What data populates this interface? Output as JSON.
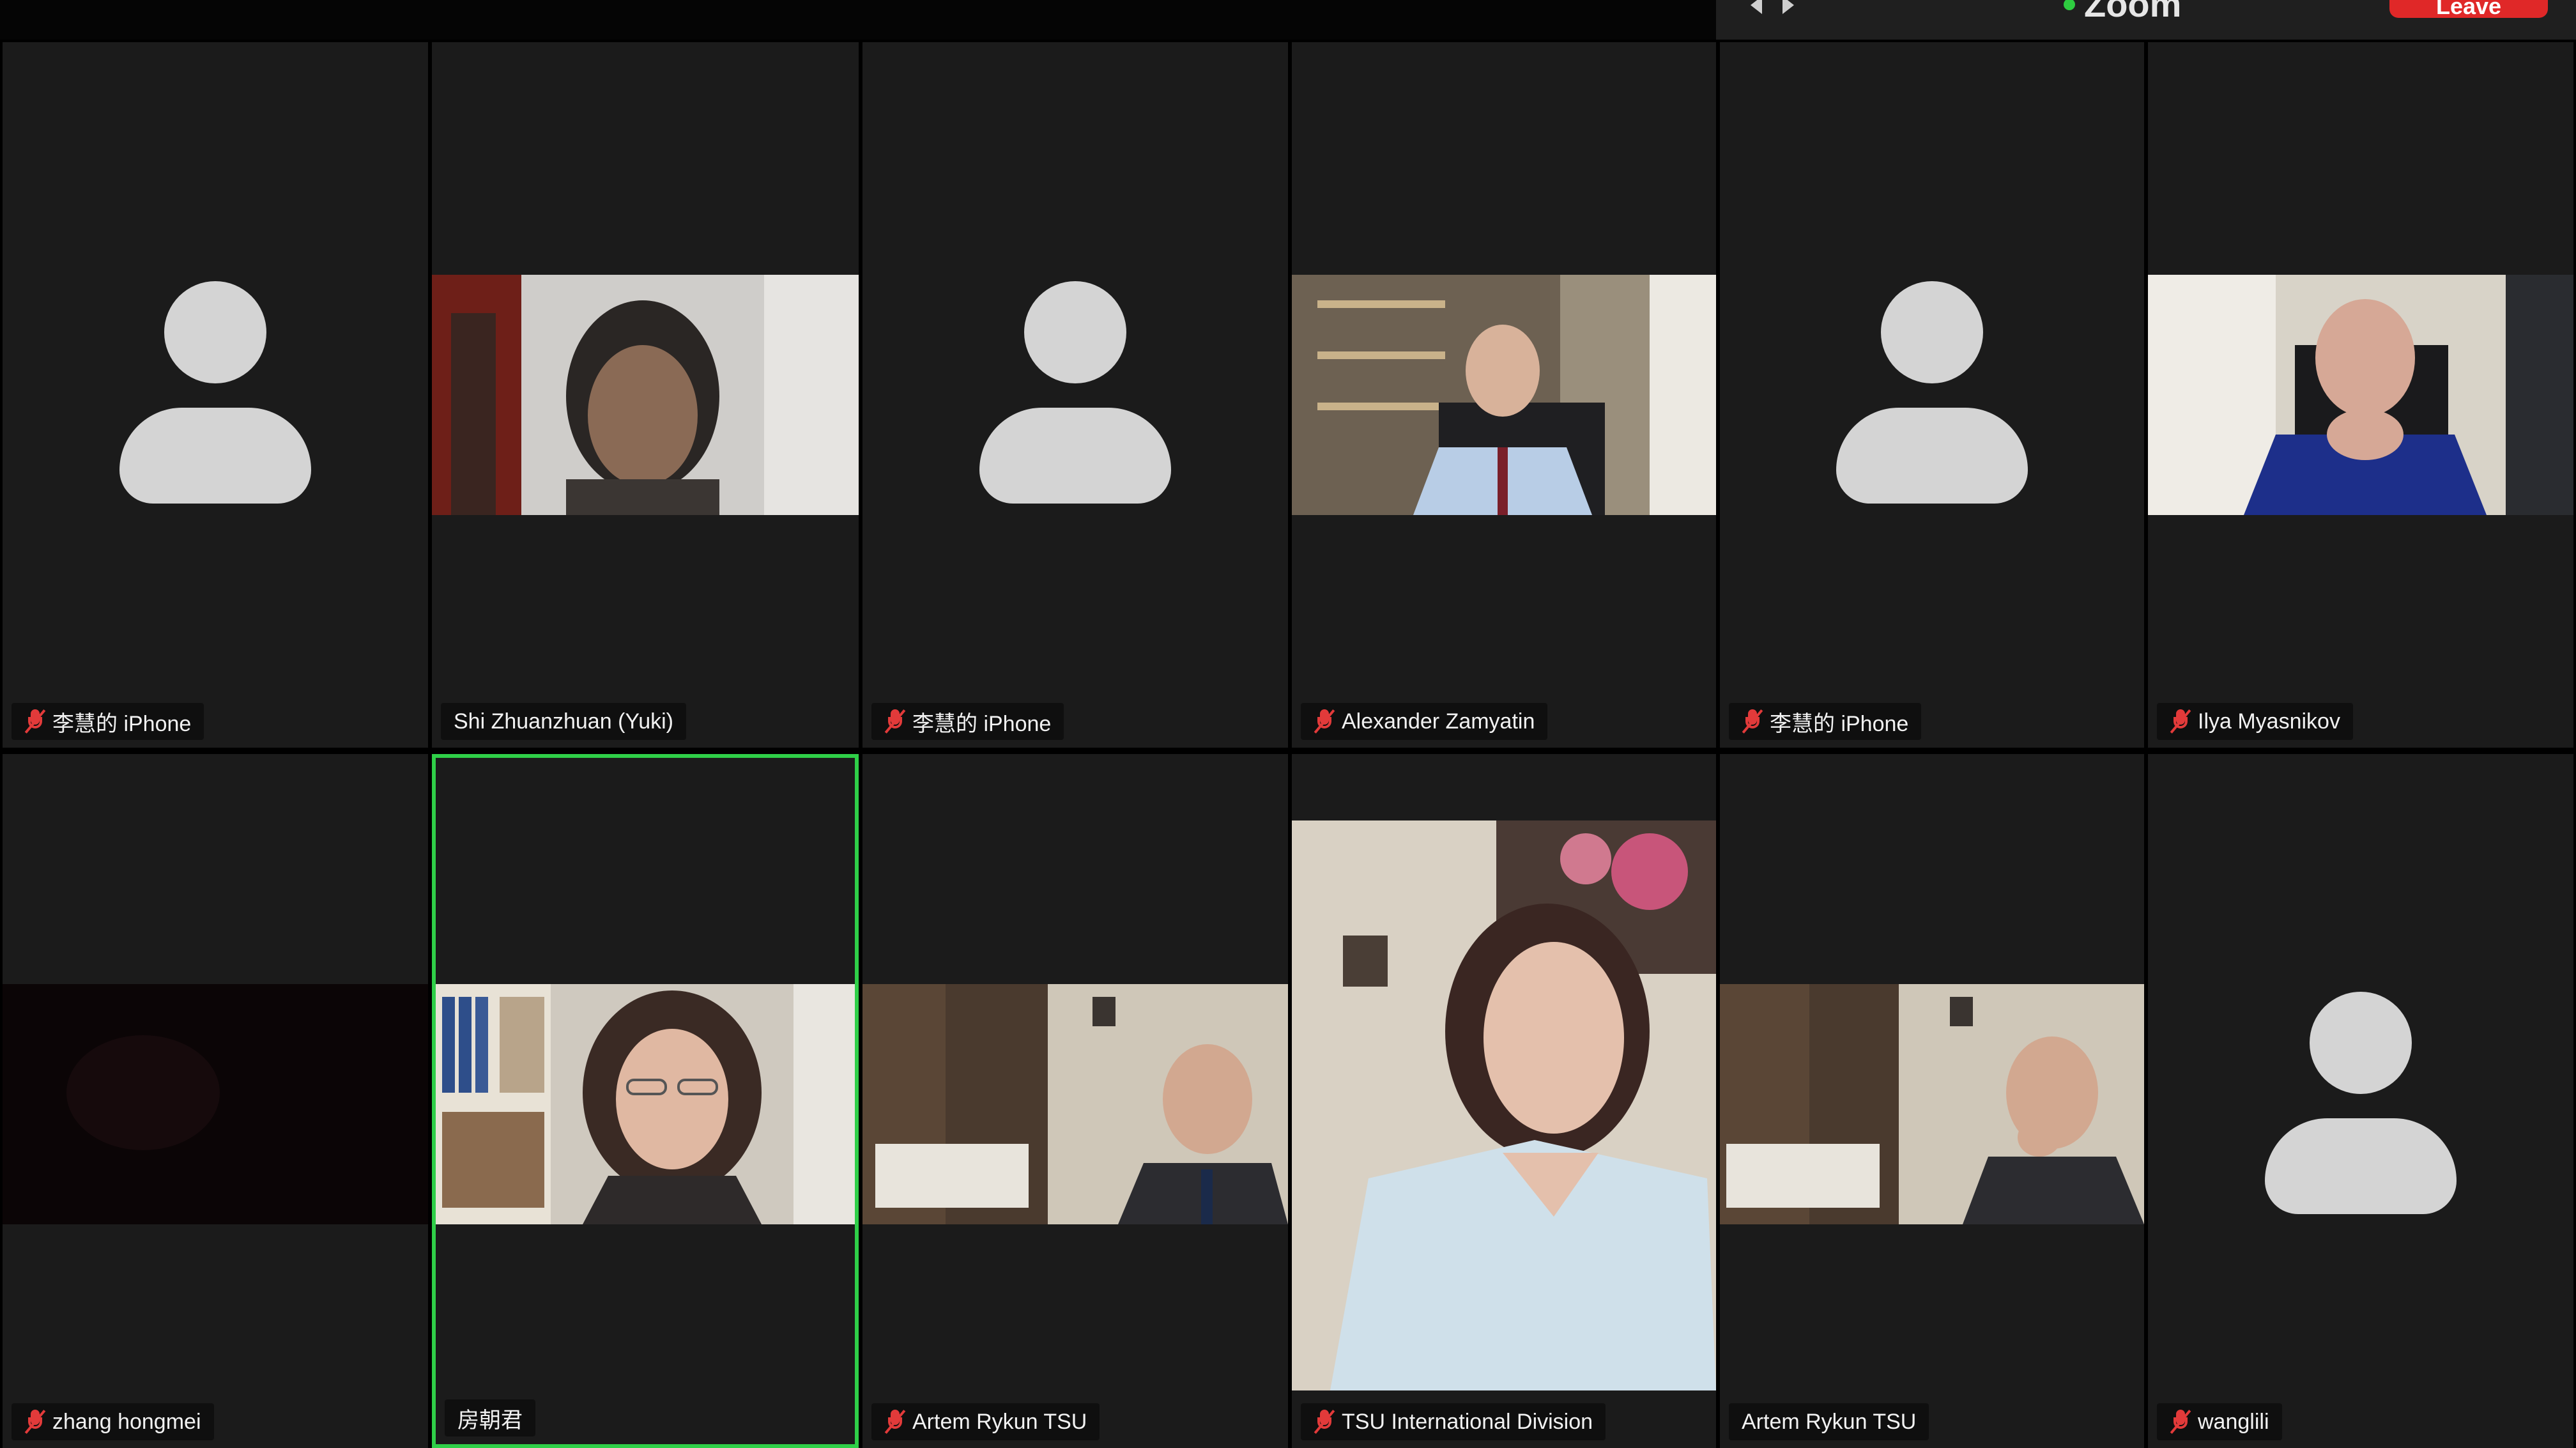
{
  "app": {
    "title": "Zoom",
    "leave_label": "Leave",
    "accent_color": "#2fcf48",
    "leave_color": "#e02828"
  },
  "participants": [
    {
      "name": "李慧的 iPhone",
      "muted": true,
      "video": false
    },
    {
      "name": "Shi Zhuanzhuan (Yuki)",
      "muted": false,
      "video": true
    },
    {
      "name": "李慧的 iPhone",
      "muted": true,
      "video": false
    },
    {
      "name": "Alexander Zamyatin",
      "muted": true,
      "video": true
    },
    {
      "name": "李慧的 iPhone",
      "muted": true,
      "video": false
    },
    {
      "name": "Ilya Myasnikov",
      "muted": true,
      "video": true
    },
    {
      "name": "zhang hongmei",
      "muted": true,
      "video": true
    },
    {
      "name": "房朝君",
      "muted": false,
      "video": true,
      "active_speaker": true
    },
    {
      "name": "Artem Rykun TSU",
      "muted": true,
      "video": true
    },
    {
      "name": "TSU International Division",
      "muted": true,
      "video": true
    },
    {
      "name": "Artem Rykun TSU",
      "muted": false,
      "video": true
    },
    {
      "name": "wanglili",
      "muted": true,
      "video": false
    }
  ]
}
